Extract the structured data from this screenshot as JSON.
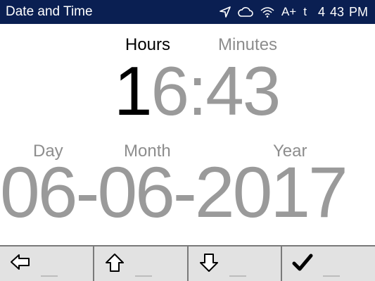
{
  "status_bar": {
    "title": "Date and Time",
    "icons": [
      "location-arrow-icon",
      "cloud-icon",
      "wifi-icon"
    ],
    "signal_text": "A+",
    "mode_text": "t",
    "time": "4 43 PM"
  },
  "time_section": {
    "hours_label": "Hours",
    "minutes_label": "Minutes",
    "hour_digit_1": "1",
    "hour_digit_2": "6",
    "separator": ":",
    "minutes": "43"
  },
  "date_section": {
    "day_label": "Day",
    "month_label": "Month",
    "year_label": "Year",
    "day": "06",
    "dash": "-",
    "month": "06",
    "year": "2017"
  },
  "softkeys": [
    {
      "icon": "left-arrow-icon"
    },
    {
      "icon": "up-arrow-icon"
    },
    {
      "icon": "down-arrow-icon"
    },
    {
      "icon": "check-icon"
    }
  ],
  "colors": {
    "status_bar_bg": "#0a1f52",
    "active": "#000000",
    "inactive": "#9a9a9a",
    "softkey_bg": "#e2e2e2"
  }
}
